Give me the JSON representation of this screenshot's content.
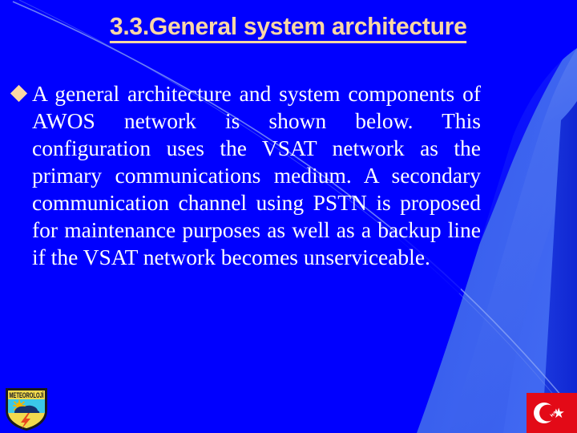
{
  "slide": {
    "background_color": "#0000FF",
    "accent_color": "#FBD7A5",
    "body_text_color": "#FFFFFF",
    "swoosh_light_color": "#3A60EE",
    "swoosh_mid_color": "#2B4FE6",
    "swoosh_dark_color": "#1333D8",
    "hairline_color": "#8FA8F5"
  },
  "title": {
    "text": "3.3.General system architecture"
  },
  "body": {
    "bullets": [
      {
        "marker": "diamond-bullet",
        "text": "A general architecture and system components of AWOS network is shown below. This configuration uses the VSAT network as the primary communications medium. A secondary communication channel using PSTN is proposed for maintenance purposes as well as a backup line if the VSAT network becomes unserviceable."
      }
    ]
  },
  "logo": {
    "name": "meteoroloji-shield-logo",
    "caption": "METEOROLOJİ",
    "colors": {
      "border": "#1A1A1A",
      "sky": "#3BC8E8",
      "sun": "#F2B400",
      "cloud": "#14306B",
      "field": "#F2DA4E",
      "bolt": "#E8461E"
    }
  },
  "flag": {
    "name": "turkish-flag",
    "red": "#E30A17",
    "white": "#FFFFFF"
  }
}
